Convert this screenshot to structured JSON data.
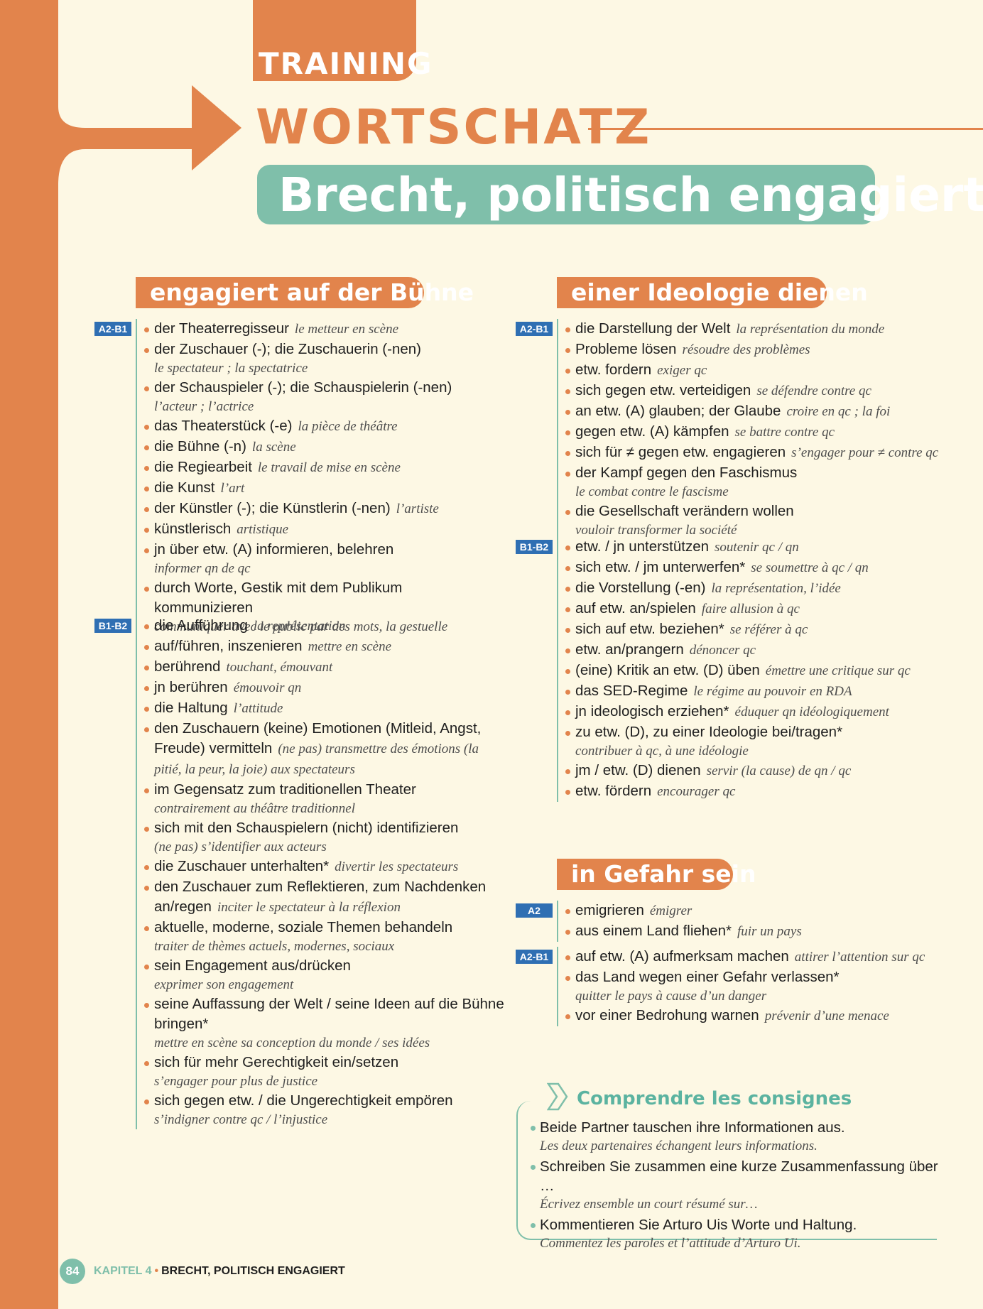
{
  "header": {
    "training": "TRAINING",
    "wortschatz": "WORTSCHATZ",
    "title": "Brecht, politisch engagiert"
  },
  "sections": {
    "left": {
      "title": "engagiert auf der Bühne",
      "groups": [
        {
          "level": "A2-B1",
          "items": [
            {
              "de": "der Theaterregisseur",
              "fr": "le metteur en scène",
              "block": false
            },
            {
              "de": "der Zuschauer (-); die Zuschauerin (-nen)",
              "fr": "le spectateur ; la spectatrice",
              "block": true
            },
            {
              "de": "der Schauspieler (-); die Schauspielerin (-nen)",
              "fr": "l’acteur ; l’actrice",
              "block": true
            },
            {
              "de": "das Theaterstück (-e)",
              "fr": "la pièce de théâtre",
              "block": false
            },
            {
              "de": "die Bühne (-n)",
              "fr": "la scène",
              "block": false
            },
            {
              "de": "die Regiearbeit",
              "fr": "le travail de mise en scène",
              "block": false
            },
            {
              "de": "die Kunst",
              "fr": "l’art",
              "block": false
            },
            {
              "de": "der Künstler (-); die Künstlerin (-nen)",
              "fr": "l’artiste",
              "block": false
            },
            {
              "de": "künstlerisch",
              "fr": "artistique",
              "block": false
            },
            {
              "de": "jn über etw. (A) informieren, belehren",
              "fr": "informer qn de qc",
              "block": true
            },
            {
              "de": "durch Worte, Gestik mit dem Publikum kommunizieren",
              "fr": "communiquer avec le public par des mots, la gestuelle",
              "block": true
            }
          ]
        },
        {
          "level": "B1-B2",
          "items": [
            {
              "de": "die Aufführung",
              "fr": "la représentation",
              "block": false
            },
            {
              "de": "auf/führen, inszenieren",
              "fr": "mettre en scène",
              "block": false
            },
            {
              "de": "berührend",
              "fr": "touchant, émouvant",
              "block": false
            },
            {
              "de": "jn berühren",
              "fr": "émouvoir qn",
              "block": false
            },
            {
              "de": "die Haltung",
              "fr": "l’attitude",
              "block": false
            },
            {
              "de": "den Zuschauern (keine) Emotionen (Mitleid, Angst, Freude) vermitteln",
              "fr": "(ne pas) transmettre des émotions (la pitié, la peur, la joie) aux spectateurs",
              "block": false
            },
            {
              "de": "im Gegensatz zum traditionellen Theater",
              "fr": "contrairement au théâtre traditionnel",
              "block": true
            },
            {
              "de": "sich mit den Schauspielern (nicht) identifizieren",
              "fr": "(ne pas) s’identifier aux acteurs",
              "block": true
            },
            {
              "de": "die Zuschauer unterhalten*",
              "fr": "divertir les spectateurs",
              "block": false
            },
            {
              "de": "den Zuschauer zum Reflektieren, zum Nachdenken an/regen",
              "fr": "inciter le spectateur à la réflexion",
              "block": false
            },
            {
              "de": "aktuelle, moderne, soziale Themen behandeln",
              "fr": "traiter de thèmes actuels, modernes, sociaux",
              "block": true
            },
            {
              "de": "sein Engagement aus/drücken",
              "fr": "exprimer son engagement",
              "block": true
            },
            {
              "de": "seine Auffassung der Welt / seine Ideen auf die Bühne bringen*",
              "fr": "mettre en scène sa conception du monde / ses idées",
              "block": true
            },
            {
              "de": "sich für mehr Gerechtigkeit ein/setzen",
              "fr": "s’engager pour plus de justice",
              "block": true
            },
            {
              "de": "sich gegen etw. / die Ungerechtigkeit empören",
              "fr": "s’indigner contre qc / l’injustice",
              "block": true
            }
          ]
        }
      ]
    },
    "right": {
      "title": "einer Ideologie dienen",
      "groups": [
        {
          "level": "A2-B1",
          "items": [
            {
              "de": "die Darstellung der Welt",
              "fr": "la représentation du monde",
              "block": false
            },
            {
              "de": "Probleme lösen",
              "fr": "résoudre des problèmes",
              "block": false
            },
            {
              "de": "etw. fordern",
              "fr": "exiger qc",
              "block": false
            },
            {
              "de": "sich gegen etw. verteidigen",
              "fr": "se défendre contre qc",
              "block": false
            },
            {
              "de": "an etw. (A) glauben; der Glaube",
              "fr": "croire en qc ; la foi",
              "block": false
            },
            {
              "de": "gegen etw. (A) kämpfen",
              "fr": "se battre contre qc",
              "block": false
            },
            {
              "de": "sich für ≠ gegen etw. engagieren",
              "fr": "s’engager pour ≠ contre qc",
              "block": false
            },
            {
              "de": "der Kampf gegen den Faschismus",
              "fr": "le combat contre le fascisme",
              "block": true
            },
            {
              "de": "die Gesellschaft verändern wollen",
              "fr": "vouloir transformer la société",
              "block": true
            }
          ]
        },
        {
          "level": "B1-B2",
          "items": [
            {
              "de": "etw. / jn unterstützen",
              "fr": "soutenir qc / qn",
              "block": false
            },
            {
              "de": "sich etw. / jm unterwerfen*",
              "fr": "se soumettre à qc / qn",
              "block": false
            },
            {
              "de": "die Vorstellung (-en)",
              "fr": "la représentation, l’idée",
              "block": false
            },
            {
              "de": "auf etw. an/spielen",
              "fr": "faire allusion à qc",
              "block": false
            },
            {
              "de": "sich auf etw. beziehen*",
              "fr": "se référer à qc",
              "block": false
            },
            {
              "de": "etw. an/prangern",
              "fr": "dénoncer qc",
              "block": false
            },
            {
              "de": "(eine) Kritik an etw. (D) üben",
              "fr": "émettre une critique sur qc",
              "block": false
            },
            {
              "de": "das SED-Regime",
              "fr": "le régime au pouvoir en RDA",
              "block": false
            },
            {
              "de": "jn ideologisch erziehen*",
              "fr": "éduquer qn idéologiquement",
              "block": false
            },
            {
              "de": "zu etw. (D), zu einer Ideologie bei/tragen*",
              "fr": "contribuer à qc, à une idéologie",
              "block": true
            },
            {
              "de": "jm / etw. (D) dienen",
              "fr": "servir (la cause) de qn / qc",
              "block": false
            },
            {
              "de": "etw. fördern",
              "fr": "encourager qc",
              "block": false
            }
          ]
        }
      ]
    },
    "danger": {
      "title": "in Gefahr sein",
      "groups": [
        {
          "level": "A2",
          "items": [
            {
              "de": "emigrieren",
              "fr": "émigrer",
              "block": false
            },
            {
              "de": "aus einem Land fliehen*",
              "fr": "fuir un pays",
              "block": false
            }
          ]
        },
        {
          "level": "A2-B1",
          "items": [
            {
              "de": "auf etw. (A) aufmerksam machen",
              "fr": "attirer l’attention sur qc",
              "block": false
            },
            {
              "de": "das Land wegen einer Gefahr verlassen*",
              "fr": "quitter le pays à cause d’un danger",
              "block": true
            },
            {
              "de": "vor einer Bedrohung warnen",
              "fr": "prévenir d’une menace",
              "block": false
            }
          ]
        }
      ]
    }
  },
  "consignes": {
    "title": "Comprendre les consignes",
    "items": [
      {
        "de": "Beide Partner tauschen ihre Informationen aus.",
        "fr": "Les deux partenaires échangent leurs informations."
      },
      {
        "de": "Schreiben Sie zusammen eine kurze Zusammenfassung über …",
        "fr": "Écrivez ensemble un court résumé sur…"
      },
      {
        "de": "Kommentieren Sie Arturo Uis Worte und Haltung.",
        "fr": "Commentez les paroles et l’attitude d’Arturo Ui."
      }
    ]
  },
  "footer": {
    "page": "84",
    "chapter": "KAPITEL 4",
    "title": "BRECHT, POLITISCH ENGAGIERT"
  },
  "colors": {
    "orange": "#e2844c",
    "teal": "#7fbfaa",
    "badge_blue": "#2f6fb3",
    "background": "#fdf8e4"
  }
}
